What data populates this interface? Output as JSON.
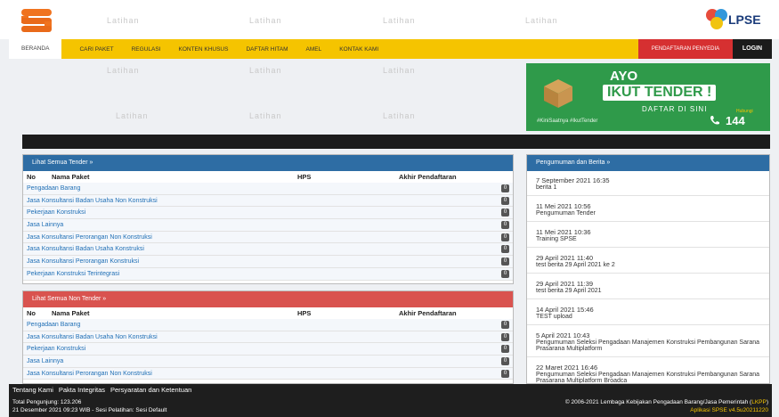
{
  "watermark": "Latihan",
  "nav": {
    "items": [
      "BERANDA",
      "CARI PAKET",
      "REGULASI",
      "KONTEN KHUSUS",
      "DAFTAR HITAM",
      "AMEL",
      "KONTAK KAMI"
    ],
    "register": "PENDAFTARAN PENYEDIA",
    "login": "LOGIN"
  },
  "banner": {
    "line1": "AYO",
    "line2": "IKUT TENDER !",
    "line3": "DAFTAR DI SINI",
    "tags": "#KiniSaatnya #IkutTender",
    "contact_label": "Hubungi",
    "contact_number": "144"
  },
  "logo": {
    "text": "LPSE"
  },
  "tender": {
    "title": "Lihat Semua Tender »",
    "columns": [
      "No",
      "Nama Paket",
      "HPS",
      "Akhir Pendaftaran"
    ],
    "rows": [
      {
        "name": "Pengadaan Barang",
        "count": "0"
      },
      {
        "name": "Jasa Konsultansi Badan Usaha Non Konstruksi",
        "count": "0"
      },
      {
        "name": "Pekerjaan Konstruksi",
        "count": "0"
      },
      {
        "name": "Jasa Lainnya",
        "count": "0"
      },
      {
        "name": "Jasa Konsultansi Perorangan Non Konstruksi",
        "count": "0"
      },
      {
        "name": "Jasa Konsultansi Badan Usaha Konstruksi",
        "count": "0"
      },
      {
        "name": "Jasa Konsultansi Perorangan Konstruksi",
        "count": "0"
      },
      {
        "name": "Pekerjaan Konstruksi Terintegrasi",
        "count": "0"
      }
    ]
  },
  "nontender": {
    "title": "Lihat Semua Non Tender »",
    "columns": [
      "No",
      "Nama Paket",
      "HPS",
      "Akhir Pendaftaran"
    ],
    "rows": [
      {
        "name": "Pengadaan Barang",
        "count": "0"
      },
      {
        "name": "Jasa Konsultansi Badan Usaha Non Konstruksi",
        "count": "0"
      },
      {
        "name": "Pekerjaan Konstruksi",
        "count": "0"
      },
      {
        "name": "Jasa Lainnya",
        "count": "0"
      },
      {
        "name": "Jasa Konsultansi Perorangan Non Konstruksi",
        "count": "0"
      }
    ]
  },
  "news": {
    "title": "Pengumuman dan Berita »",
    "items": [
      {
        "date": "7 September 2021 16:35",
        "text": "berita 1"
      },
      {
        "date": "11 Mei 2021 10:56",
        "text": "Pengumuman Tender"
      },
      {
        "date": "11 Mei 2021 10:36",
        "text": "Training SPSE"
      },
      {
        "date": "29 April 2021 11:40",
        "text": "test berita 29 April 2021 ke 2"
      },
      {
        "date": "29 April 2021 11:39",
        "text": "test berita 29 April 2021"
      },
      {
        "date": "14 April 2021 15:46",
        "text": "TEST upload"
      },
      {
        "date": "5 April 2021 10:43",
        "text": "Pengumuman Seleksi Pengadaan Manajemen Konstruksi Pembangunan Sarana Prasarana Multiplatform"
      },
      {
        "date": "22 Maret 2021 16:46",
        "text": "Pengumuman Seleksi Pengadaan Manajemen Konstruksi Pembangunan Sarana Prasarana Multiplatform Broadca"
      }
    ]
  },
  "footer": {
    "links": [
      "Tentang Kami",
      "Pakta Integritas",
      "Persyaratan dan Ketentuan"
    ],
    "visitors": "Total Pengunjung: 123.206",
    "session": "21 Desember 2021 09:23 WIB - Sesi Pelatihan: Sesi Default",
    "copyright_pre": "© 2006-2021 Lembaga Kebijakan Pengadaan Barang/Jasa Pemerintah (",
    "copyright_link": "LKPP",
    "copyright_post": ")",
    "version": "Aplikasi SPSE v4.5u20211220"
  },
  "colors": {
    "nav": "#f5c400",
    "tender": "#2e6da4",
    "nontender": "#d9534f",
    "news": "#2e6da4",
    "register": "#d63031"
  }
}
